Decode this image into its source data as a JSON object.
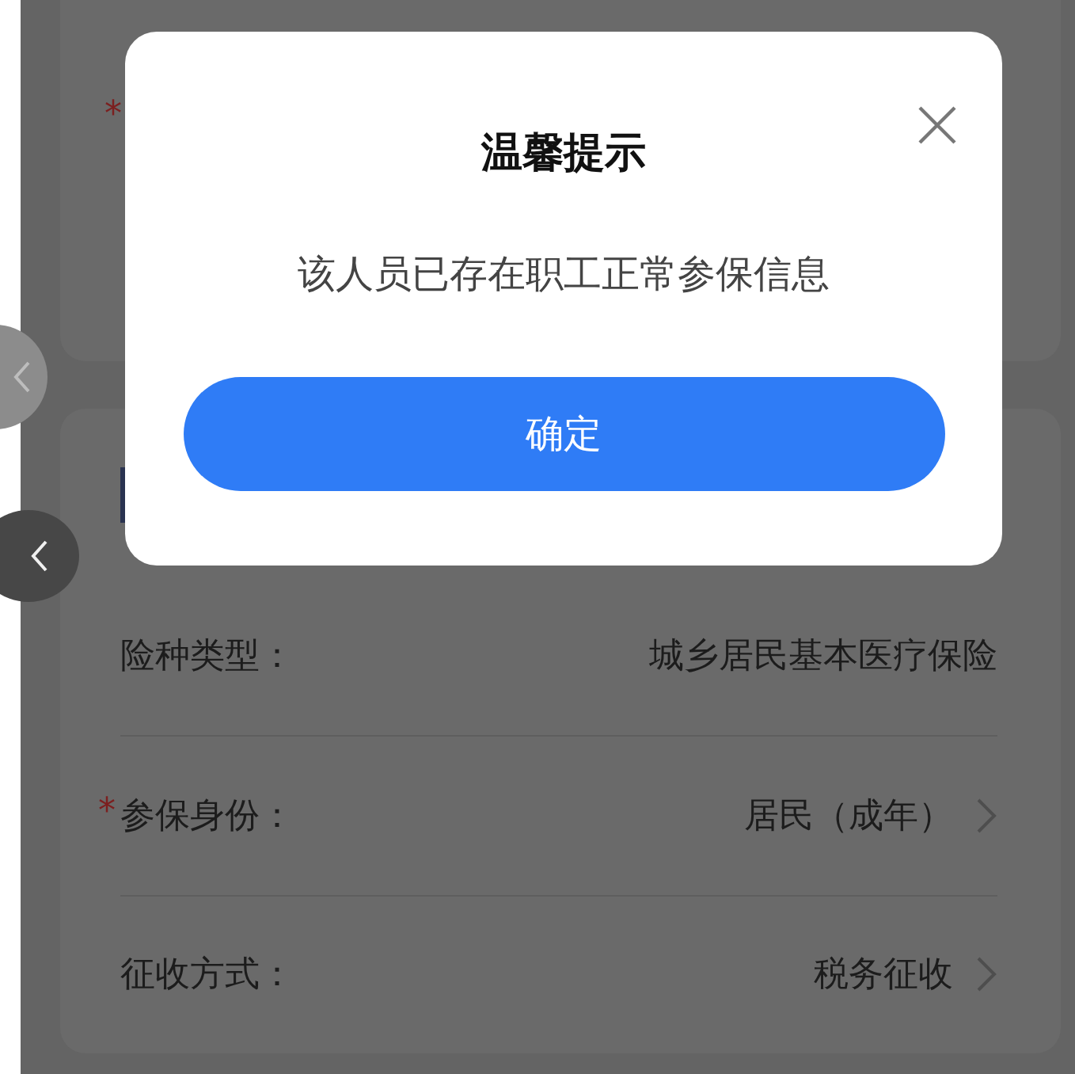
{
  "top_card": {
    "required_mark": "*"
  },
  "form_rows": [
    {
      "label": "险种类型：",
      "value": "城乡居民基本医疗保险",
      "chevron": false
    },
    {
      "required_mark": "*",
      "label": "参保身份：",
      "value": "居民（成年）",
      "chevron": true
    },
    {
      "label": "征收方式：",
      "value": "税务征收",
      "chevron": true
    }
  ],
  "dialog": {
    "title": "温馨提示",
    "message": "该人员已存在职工正常参保信息",
    "confirm_button": "确定"
  }
}
